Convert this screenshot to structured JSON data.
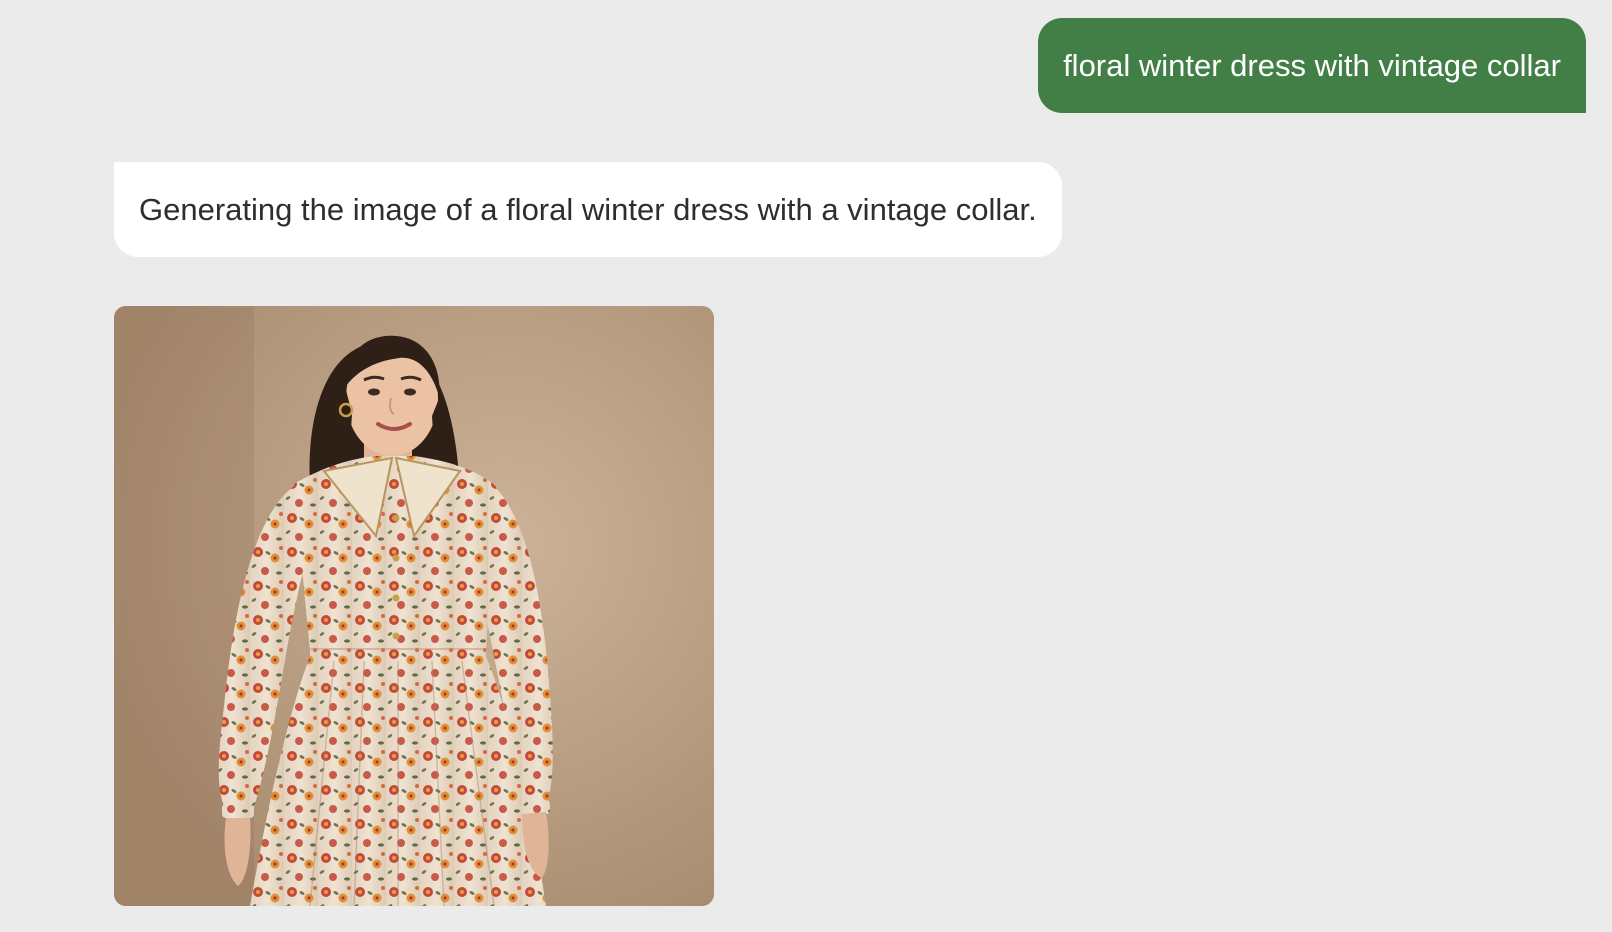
{
  "conversation": {
    "user_message": "floral winter dress with vintage collar",
    "assistant_message": "Generating the image of a floral winter dress with a vintage collar.",
    "image": {
      "subject": "woman wearing a long-sleeve floral winter dress with a cream vintage collar",
      "background_color": "#c2a88c"
    }
  },
  "colors": {
    "page_background": "#ebebeb",
    "user_bubble": "#427f47",
    "assistant_bubble": "#ffffff"
  }
}
